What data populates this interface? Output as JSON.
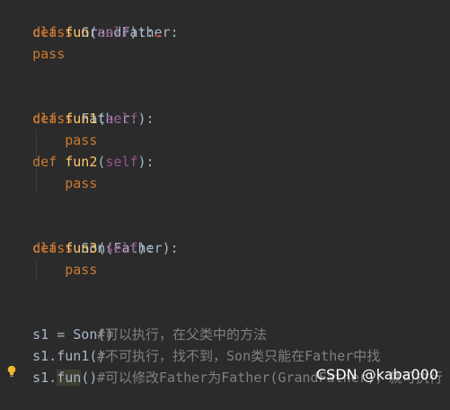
{
  "code": {
    "l1": {
      "kw": "class",
      "name": "GrandFather",
      "colon": ":"
    },
    "l2": {
      "kw": "def",
      "fn": "fun",
      "open": "(",
      "self": "self",
      "close": ")::"
    },
    "l3": {
      "kw": "pass"
    },
    "l5": {
      "kw": "class",
      "name": "Father",
      "colon": ":"
    },
    "l6": {
      "kw": "def",
      "fn": "fun1",
      "open": "(",
      "self": "self",
      "close": "):"
    },
    "l7": {
      "kw": "pass"
    },
    "l8": {
      "kw": "def",
      "fn": "fun2",
      "open": "(",
      "self": "self",
      "close": "):"
    },
    "l9": {
      "kw": "pass"
    },
    "l11": {
      "kw": "class",
      "name": "Son(Father)",
      "colon": ":"
    },
    "l12": {
      "kw": "def",
      "fn": "fun3",
      "open": "(",
      "self": "self",
      "close": "):"
    },
    "l13": {
      "kw": "pass"
    },
    "l15": {
      "text": "s1 = Son()"
    },
    "l16": {
      "code": "s1.fun1()",
      "comment": "#可以执行，在父类中的方法"
    },
    "l17": {
      "prefix": "s1.",
      "hl": "fun",
      "suffix": "()",
      "comment": "#不可执行，找不到，Son类只能在Father中找"
    },
    "l18": {
      "comment": "#可以修改Father为Father(GrandFather)，就可执行"
    }
  },
  "icons": {
    "gutter": "lightbulb-icon",
    "warning": "squiggle-warning-icon"
  },
  "colors": {
    "background": "#2b2b2b",
    "keyword": "#cc7832",
    "function": "#ffc66d",
    "self": "#94558d",
    "comment": "#808080"
  },
  "watermark": {
    "text": "CSDN @kaba000"
  }
}
